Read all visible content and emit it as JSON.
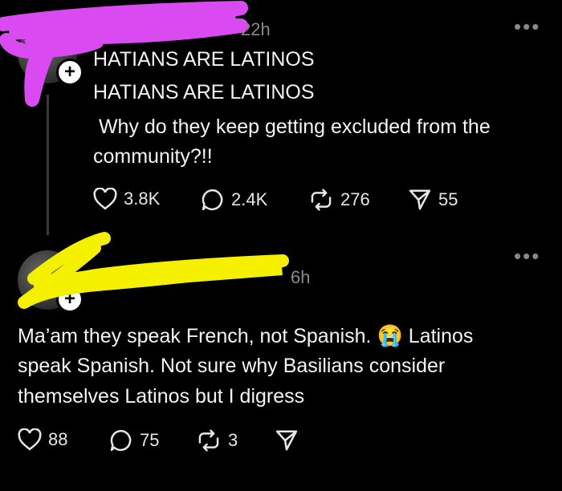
{
  "post1": {
    "time": "22h",
    "line1": "HATIANS ARE LATINOS",
    "line2": "HATIANS ARE LATINOS",
    "line3": " Why do they keep getting excluded from the",
    "line4": "community?!!",
    "likes": "3.8K",
    "comments": "2.4K",
    "reposts": "276",
    "shares": "55",
    "more_icon": "more-horizontal-icon"
  },
  "post2": {
    "time": "6h",
    "line1_a": "Ma’am they speak French, not Spanish.",
    "emoji": "😭",
    "line1_b": "Latinos",
    "line2": "speak Spanish. Not sure why Basilians consider",
    "line3": "themselves Latinos but I digress",
    "likes": "88",
    "comments": "75",
    "reposts": "3",
    "more_icon": "more-horizontal-icon"
  },
  "colors": {
    "background": "#000000",
    "text": "#f3f3f3",
    "muted": "#8a8a8a",
    "redaction_pink": "#d94bf0",
    "redaction_yellow": "#f4f000"
  }
}
